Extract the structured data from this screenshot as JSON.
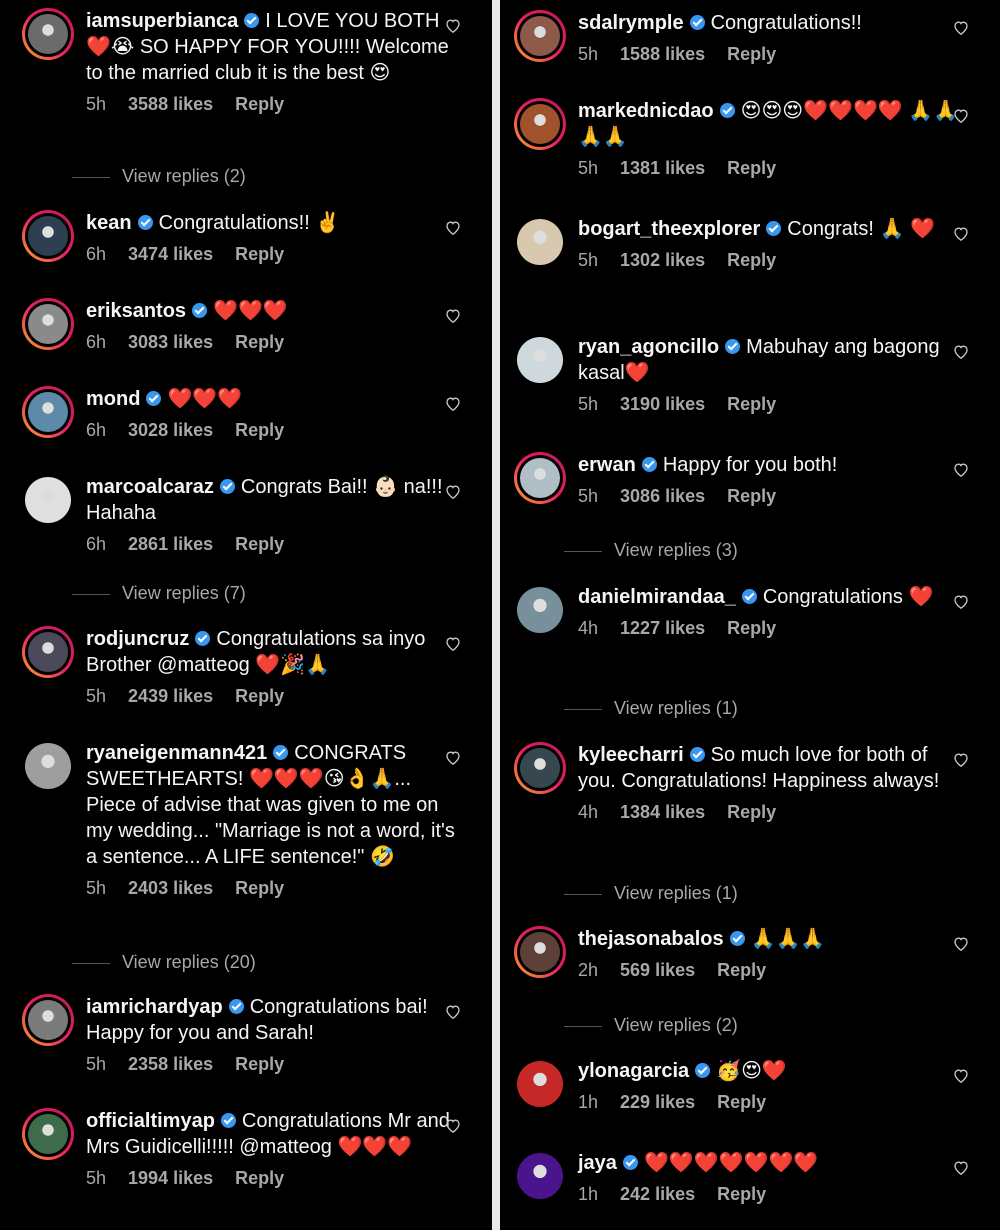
{
  "left_column": [
    {
      "user": "iamsuperbianca",
      "text": "I LOVE YOU BOTH ❤️😭 SO HAPPY FOR YOU!!!! Welcome to the married club it is the best 😍",
      "time": "5h",
      "likes": "3588 likes",
      "reply": "Reply",
      "view_replies": "View replies (2)",
      "avatar_color": "#6b6b6b"
    },
    {
      "user": "kean",
      "text": "Congratulations!! ✌️",
      "time": "6h",
      "likes": "3474 likes",
      "reply": "Reply",
      "view_replies": "",
      "avatar_color": "#2c3e50"
    },
    {
      "user": "eriksantos",
      "text": "❤️❤️❤️",
      "time": "6h",
      "likes": "3083 likes",
      "reply": "Reply",
      "view_replies": "",
      "avatar_color": "#8a8a8a"
    },
    {
      "user": "mond",
      "text": "❤️❤️❤️",
      "time": "6h",
      "likes": "3028 likes",
      "reply": "Reply",
      "view_replies": "",
      "avatar_color": "#5d8aa8"
    },
    {
      "user": "marcoalcaraz",
      "text": "Congrats Bai!! 👶🏻 na!!! Hahaha",
      "time": "6h",
      "likes": "2861 likes",
      "reply": "Reply",
      "view_replies": "View replies (7)",
      "avatar_color": "#e0e0e0"
    },
    {
      "user": "rodjuncruz",
      "text": "Congratulations sa inyo Brother @matteog ❤️🎉🙏",
      "time": "5h",
      "likes": "2439 likes",
      "reply": "Reply",
      "view_replies": "",
      "avatar_color": "#4a4a5a"
    },
    {
      "user": "ryaneigenmann421",
      "text": "CONGRATS SWEETHEARTS! ❤️❤️❤️😘👌🙏... Piece of advise that was given to me on my wedding... \"Marriage is not a word, it's a sentence... A LIFE sentence!\" 🤣",
      "time": "5h",
      "likes": "2403 likes",
      "reply": "Reply",
      "view_replies": "View replies (20)",
      "avatar_color": "#9e9e9e"
    },
    {
      "user": "iamrichardyap",
      "text": "Congratulations bai! Happy for you and Sarah!",
      "time": "5h",
      "likes": "2358 likes",
      "reply": "Reply",
      "view_replies": "",
      "avatar_color": "#7b7b7b"
    },
    {
      "user": "officialtimyap",
      "text": "Congratulations Mr and Mrs Guidicelli!!!!! @matteog ❤️❤️❤️",
      "time": "5h",
      "likes": "1994 likes",
      "reply": "Reply",
      "view_replies": "",
      "avatar_color": "#3e6b4a"
    }
  ],
  "right_column": [
    {
      "user": "sdalrymple",
      "text": "Congratulations!!",
      "time": "5h",
      "likes": "1588 likes",
      "reply": "Reply",
      "view_replies": "",
      "avatar_color": "#8d5a4a"
    },
    {
      "user": "markednicdao",
      "text": "😍😍😍❤️❤️❤️❤️ 🙏🙏🙏🙏",
      "time": "5h",
      "likes": "1381 likes",
      "reply": "Reply",
      "view_replies": "",
      "avatar_color": "#a0522d"
    },
    {
      "user": "bogart_theexplorer",
      "text": "Congrats! 🙏 ❤️",
      "time": "5h",
      "likes": "1302 likes",
      "reply": "Reply",
      "view_replies": "",
      "avatar_color": "#d8c8b0"
    },
    {
      "user": "ryan_agoncillo",
      "text": "Mabuhay ang bagong kasal❤️",
      "time": "5h",
      "likes": "3190 likes",
      "reply": "Reply",
      "view_replies": "",
      "avatar_color": "#cfd8dc"
    },
    {
      "user": "erwan",
      "text": "Happy for you both!",
      "time": "5h",
      "likes": "3086 likes",
      "reply": "Reply",
      "view_replies": "View replies (3)",
      "avatar_color": "#b0bec5"
    },
    {
      "user": "danielmirandaa_",
      "text": "Congratulations ❤️",
      "time": "4h",
      "likes": "1227 likes",
      "reply": "Reply",
      "view_replies": "View replies (1)",
      "avatar_color": "#78909c"
    },
    {
      "user": "kyleecharri",
      "text": "So much love for both of you. Congratulations! Happiness always!",
      "time": "4h",
      "likes": "1384 likes",
      "reply": "Reply",
      "view_replies": "View replies (1)",
      "avatar_color": "#37474f"
    },
    {
      "user": "thejasonabalos",
      "text": "🙏🙏🙏",
      "time": "2h",
      "likes": "569 likes",
      "reply": "Reply",
      "view_replies": "View replies (2)",
      "avatar_color": "#5d4037"
    },
    {
      "user": "ylonagarcia",
      "text": "🥳😍❤️",
      "time": "1h",
      "likes": "229 likes",
      "reply": "Reply",
      "view_replies": "",
      "avatar_color": "#c62828"
    },
    {
      "user": "jaya",
      "text": "❤️❤️❤️❤️❤️❤️❤️",
      "time": "1h",
      "likes": "242 likes",
      "reply": "Reply",
      "view_replies": "",
      "avatar_color": "#4a148c"
    }
  ],
  "heart_icon": "heart-outline-icon",
  "verified_icon": "verified-badge-icon"
}
